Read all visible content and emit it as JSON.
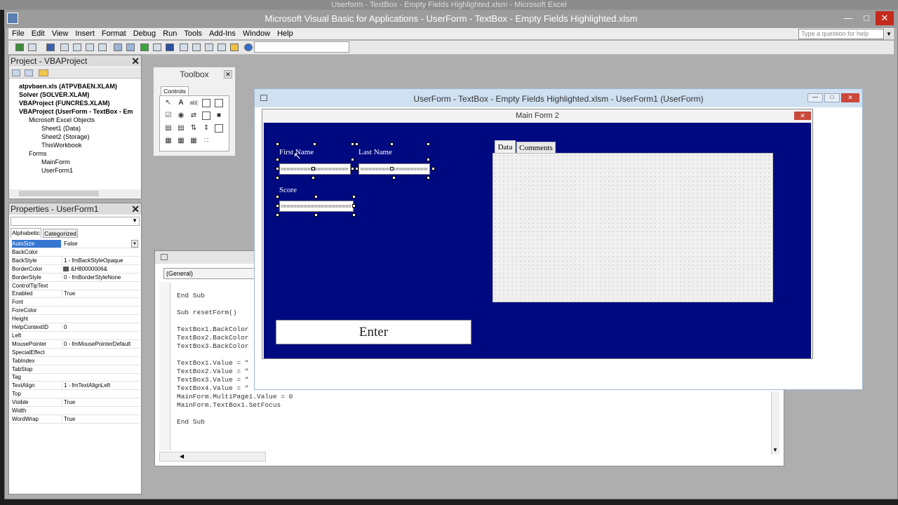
{
  "excel_title": "Userform - TextBox - Empty Fields Highlighted.xlsm - Microsoft Excel",
  "vbe_title": "Microsoft Visual Basic for Applications - UserForm - TextBox - Empty Fields Highlighted.xlsm",
  "menu": [
    "File",
    "Edit",
    "View",
    "Insert",
    "Format",
    "Debug",
    "Run",
    "Tools",
    "Add-Ins",
    "Window",
    "Help"
  ],
  "question_placeholder": "Type a question for help",
  "project": {
    "title": "Project - VBAProject",
    "items": [
      {
        "label": "atpvbaen.xls (ATPVBAEN.XLAM)",
        "bold": true
      },
      {
        "label": "Solver (SOLVER.XLAM)",
        "bold": true
      },
      {
        "label": "VBAProject (FUNCRES.XLAM)",
        "bold": true
      },
      {
        "label": "VBAProject (UserForm - TextBox - Em",
        "bold": true
      },
      {
        "label": "Microsoft Excel Objects",
        "bold": false
      },
      {
        "label": "Sheet1 (Data)",
        "bold": false
      },
      {
        "label": "Sheet2 (Storage)",
        "bold": false
      },
      {
        "label": "ThisWorkbook",
        "bold": false
      },
      {
        "label": "Forms",
        "bold": false
      },
      {
        "label": "MainForm",
        "bold": false
      },
      {
        "label": "UserForm1",
        "bold": false
      }
    ]
  },
  "properties": {
    "title": "Properties - UserForm1",
    "tab_alpha": "Alphabetic",
    "tab_cat": "Categorized",
    "rows": [
      {
        "k": "AutoSize",
        "v": "False"
      },
      {
        "k": "BackColor",
        "v": ""
      },
      {
        "k": "BackStyle",
        "v": "1 - fmBackStyleOpaque"
      },
      {
        "k": "BorderColor",
        "v": "&H80000006&"
      },
      {
        "k": "BorderStyle",
        "v": "0 - fmBorderStyleNone"
      },
      {
        "k": "ControlTipText",
        "v": ""
      },
      {
        "k": "Enabled",
        "v": "True"
      },
      {
        "k": "Font",
        "v": ""
      },
      {
        "k": "ForeColor",
        "v": ""
      },
      {
        "k": "Height",
        "v": ""
      },
      {
        "k": "HelpContextID",
        "v": "0"
      },
      {
        "k": "Left",
        "v": ""
      },
      {
        "k": "MousePointer",
        "v": "0 - fmMousePointerDefault"
      },
      {
        "k": "SpecialEffect",
        "v": ""
      },
      {
        "k": "TabIndex",
        "v": ""
      },
      {
        "k": "TabStop",
        "v": ""
      },
      {
        "k": "Tag",
        "v": ""
      },
      {
        "k": "TextAlign",
        "v": "1 - fmTextAlignLeft"
      },
      {
        "k": "Top",
        "v": ""
      },
      {
        "k": "Visible",
        "v": "True"
      },
      {
        "k": "Width",
        "v": ""
      },
      {
        "k": "WordWrap",
        "v": "True"
      }
    ]
  },
  "toolbox": {
    "title": "Toolbox",
    "tab": "Controls"
  },
  "code_window": {
    "general": "(General)",
    "lines": [
      "End Sub",
      "",
      "Sub resetForm()",
      "",
      "TextBox1.BackColor",
      "TextBox2.BackColor",
      "TextBox3.BackColor",
      "",
      "TextBox1.Value = \"",
      "TextBox2.Value = \"",
      "TextBox3.Value = \"",
      "TextBox4.Value = \"",
      "MainForm.MultiPage1.Value = 0",
      "MainForm.TextBox1.SetFocus",
      "",
      "End Sub"
    ]
  },
  "designer": {
    "title": "UserForm - TextBox - Empty Fields Highlighted.xlsm - UserForm1 (UserForm)",
    "form_caption": "Main Form 2",
    "first_name": "First Name",
    "last_name": "Last Name",
    "score": "Score",
    "tab_data": "Data",
    "tab_comments": "Comments",
    "enter_button": "Enter"
  },
  "colors": {
    "form_bg": "#000a80",
    "accent_close": "#c42b1c"
  }
}
